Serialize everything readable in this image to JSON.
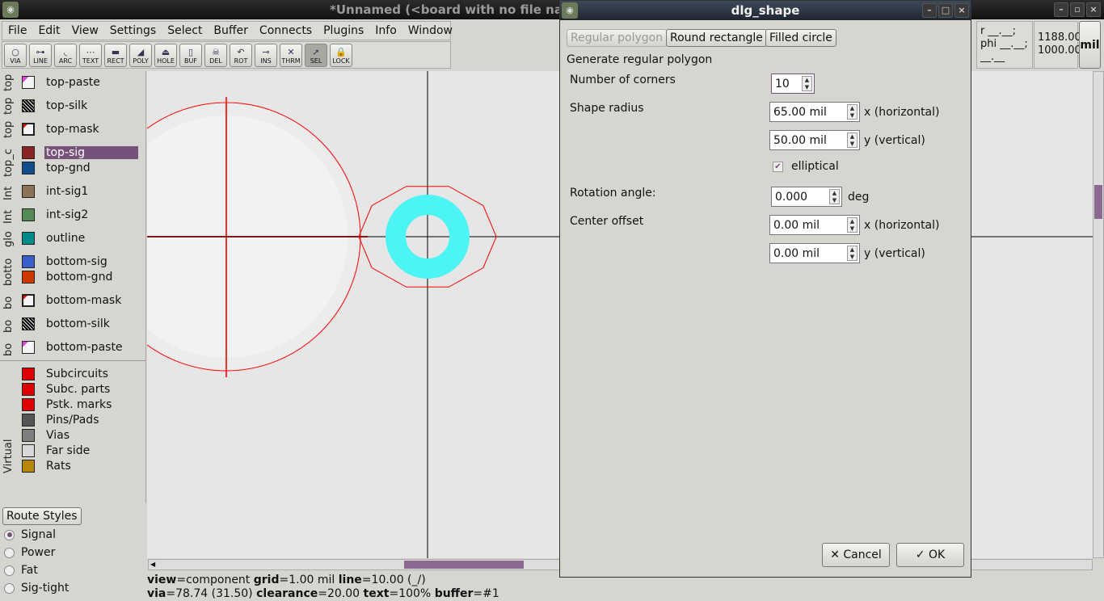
{
  "window": {
    "title": "*Unnamed (<board with no file name",
    "icon": "pcb-rnd-icon"
  },
  "menu": [
    "File",
    "Edit",
    "View",
    "Settings",
    "Select",
    "Buffer",
    "Connects",
    "Plugins",
    "Info",
    "Window"
  ],
  "tools": [
    {
      "label": "VIA",
      "g": "○"
    },
    {
      "label": "LINE",
      "g": "⊶"
    },
    {
      "label": "ARC",
      "g": "◟"
    },
    {
      "label": "TEXT",
      "g": "⋯"
    },
    {
      "label": "RECT",
      "g": "▬"
    },
    {
      "label": "POLY",
      "g": "◢"
    },
    {
      "label": "HOLE",
      "g": "⏏"
    },
    {
      "label": "BUF",
      "g": "▯"
    },
    {
      "label": "DEL",
      "g": "☠"
    },
    {
      "label": "ROT",
      "g": "↶"
    },
    {
      "label": "INS",
      "g": "⊸"
    },
    {
      "label": "THRM",
      "g": "✕"
    },
    {
      "label": "SEL",
      "g": "➚"
    },
    {
      "label": "LOCK",
      "g": "🔒"
    }
  ],
  "selected_tool": "SEL",
  "status_box": {
    "polar_r": "r __.__;",
    "polar_phi": "phi __.__;",
    "polar_xy": "__.__ __.__",
    "coord_x": "1188.00",
    "coord_y": "1000.00",
    "unit": "mil"
  },
  "layer_groups": [
    {
      "label": "top",
      "layers": [
        {
          "name": "top-paste",
          "color": "#f4f4f4",
          "pattern": "paste"
        }
      ]
    },
    {
      "label": "top",
      "layers": [
        {
          "name": "top-silk",
          "color": "#000000",
          "pattern": "hatch"
        }
      ]
    },
    {
      "label": "top",
      "layers": [
        {
          "name": "top-mask",
          "color": "#f4f4f4",
          "pattern": "mask"
        }
      ]
    },
    {
      "label": "top_c",
      "layers": [
        {
          "name": "top-sig",
          "color": "#8b2323",
          "active": true
        },
        {
          "name": "top-gnd",
          "color": "#104e8b"
        }
      ]
    },
    {
      "label": "Int",
      "layers": [
        {
          "name": "int-sig1",
          "color": "#8b7355"
        }
      ]
    },
    {
      "label": "Int",
      "layers": [
        {
          "name": "int-sig2",
          "color": "#548b54"
        }
      ]
    },
    {
      "label": "glo",
      "layers": [
        {
          "name": "outline",
          "color": "#008b8b"
        }
      ]
    },
    {
      "label": "botto",
      "layers": [
        {
          "name": "bottom-sig",
          "color": "#3a5fcd"
        },
        {
          "name": "bottom-gnd",
          "color": "#cd3700"
        }
      ]
    },
    {
      "label": "bo",
      "layers": [
        {
          "name": "bottom-mask",
          "color": "#f4f4f4",
          "pattern": "mask"
        }
      ]
    },
    {
      "label": "bo",
      "layers": [
        {
          "name": "bottom-silk",
          "color": "#000000",
          "pattern": "hatch"
        }
      ]
    },
    {
      "label": "bo",
      "layers": [
        {
          "name": "bottom-paste",
          "color": "#f4f4f4",
          "pattern": "paste"
        }
      ]
    }
  ],
  "virtual": {
    "label": "Virtual",
    "layers": [
      {
        "name": "Subcircuits",
        "color": "#dd0000"
      },
      {
        "name": "Subc. parts",
        "color": "#dd0000"
      },
      {
        "name": "Pstk. marks",
        "color": "#dd0000"
      },
      {
        "name": "Pins/Pads",
        "color": "#555555"
      },
      {
        "name": "Vias",
        "color": "#7f7f7f"
      },
      {
        "name": "Far side",
        "color": "#d8d8d8"
      },
      {
        "name": "Rats",
        "color": "#b8860b"
      }
    ]
  },
  "route_styles": {
    "button": "Route Styles",
    "items": [
      {
        "name": "Signal",
        "selected": true
      },
      {
        "name": "Power"
      },
      {
        "name": "Fat"
      },
      {
        "name": "Sig-tight"
      }
    ]
  },
  "statusline": {
    "l1": [
      [
        "view",
        "component"
      ],
      [
        "grid",
        "1.00 mil"
      ],
      [
        "line",
        "10.00 (_/)"
      ]
    ],
    "l2": [
      [
        "via",
        "78.74 (31.50)"
      ],
      [
        "clearance",
        "20.00"
      ],
      [
        "text",
        "100%"
      ],
      [
        "buffer",
        "#1"
      ]
    ]
  },
  "dialog": {
    "title": "dlg_shape",
    "tabs": [
      "Regular polygon",
      "Round rectangle",
      "Filled circle"
    ],
    "active_tab": "Regular polygon",
    "heading": "Generate regular polygon",
    "corners_label": "Number of corners",
    "corners": "10",
    "radius_label": "Shape radius",
    "radius_x": "65.00 mil",
    "radius_x_unit": "x (horizontal)",
    "radius_y": "50.00 mil",
    "radius_y_unit": "y (vertical)",
    "elliptical_label": "elliptical",
    "elliptical": true,
    "rotation_label": "Rotation angle:",
    "rotation": "0.000",
    "rotation_unit": "deg",
    "offset_label": "Center offset",
    "offset_x": "0.00 mil",
    "offset_x_unit": "x (horizontal)",
    "offset_y": "0.00 mil",
    "offset_y_unit": "y (vertical)",
    "cancel": "Cancel",
    "ok": "OK"
  },
  "colors": {
    "accent": "#76527a",
    "preview_outline": "#ff0000",
    "via": "#4cf4f4",
    "crosshair": "#000000"
  }
}
